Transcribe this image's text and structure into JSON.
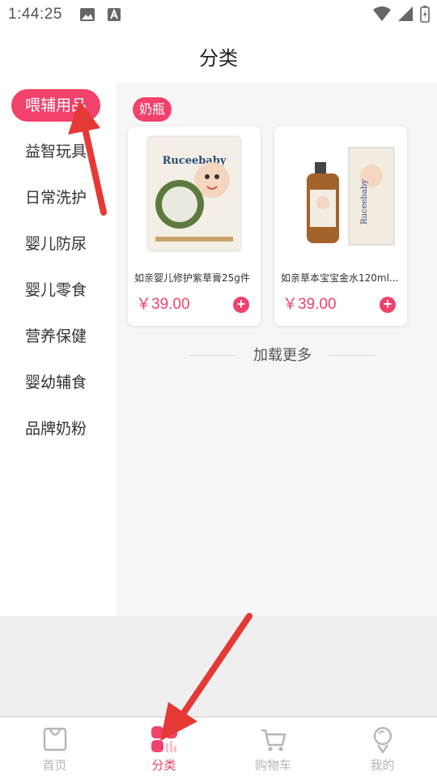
{
  "status": {
    "time": "1:44:25"
  },
  "header": {
    "title": "分类"
  },
  "sidebar": {
    "items": [
      {
        "label": "喂辅用品",
        "active": true
      },
      {
        "label": "益智玩具"
      },
      {
        "label": "日常洗护"
      },
      {
        "label": "婴儿防尿"
      },
      {
        "label": "婴儿零食"
      },
      {
        "label": "营养保健"
      },
      {
        "label": "婴幼辅食"
      },
      {
        "label": "品牌奶粉"
      }
    ]
  },
  "content": {
    "section_tag": "奶瓶",
    "products": [
      {
        "name": "如亲婴儿修护紫草膏25g件",
        "price": "￥39.00",
        "brand": "Ruceebaby"
      },
      {
        "name": "如亲草本宝宝金水120ml...",
        "price": "￥39.00",
        "brand": "Ruceebaby"
      }
    ],
    "load_more": "加载更多"
  },
  "tabbar": {
    "tabs": [
      {
        "label": "首页",
        "icon": "bag-icon"
      },
      {
        "label": "分类",
        "icon": "category-grid-icon",
        "active": true
      },
      {
        "label": "购物车",
        "icon": "cart-icon"
      },
      {
        "label": "我的",
        "icon": "profile-icon"
      }
    ]
  },
  "colors": {
    "accent": "#f2416b",
    "arrow": "#e53935"
  }
}
